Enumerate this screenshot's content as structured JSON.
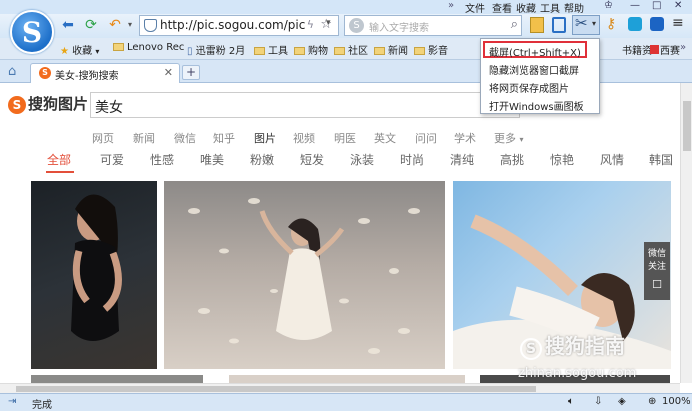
{
  "menu": [
    "文件",
    "查看",
    "收藏",
    "工具",
    "帮助"
  ],
  "toolbar": {
    "url": "http://pic.sogou.com/pic",
    "search_placeholder": "输入文字搜索",
    "logo_letter": "S"
  },
  "bookmarks": {
    "favorites_label": "收藏",
    "items": [
      "Lenovo Rec",
      "迅雷粉 2月",
      "工具",
      "购物",
      "社区",
      "新闻",
      "影音"
    ],
    "right_items": [
      "书籍资",
      "西赛"
    ]
  },
  "tab": {
    "title": "美女-搜狗搜索",
    "new_tab": "+"
  },
  "page": {
    "logo_text": "搜狗图片",
    "query": "美女",
    "nav": [
      "网页",
      "新闻",
      "微信",
      "知乎",
      "图片",
      "视频",
      "明医",
      "英文",
      "问问",
      "学术",
      "更多"
    ],
    "nav_active": "图片",
    "categories": [
      "全部",
      "可爱",
      "性感",
      "唯美",
      "粉嫩",
      "短发",
      "泳装",
      "时尚",
      "清纯",
      "高挑",
      "惊艳",
      "风情",
      "韩国"
    ],
    "category_active": "全部"
  },
  "popup": {
    "items": [
      "截屏(Ctrl+Shift+X)",
      "隐藏浏览器窗口截屏",
      "将网页保存成图片",
      "打开Windows画图板"
    ]
  },
  "side_widget": {
    "line1": "微信",
    "line2": "关注"
  },
  "watermark": {
    "brand": "搜狗指南",
    "url": "zhinan.sogou.com"
  },
  "status": {
    "text": "完成",
    "zoom": "100%"
  },
  "colors": {
    "accent": "#e34f3a",
    "sogou_orange": "#f26b1d",
    "highlight_box": "#e0303a"
  }
}
